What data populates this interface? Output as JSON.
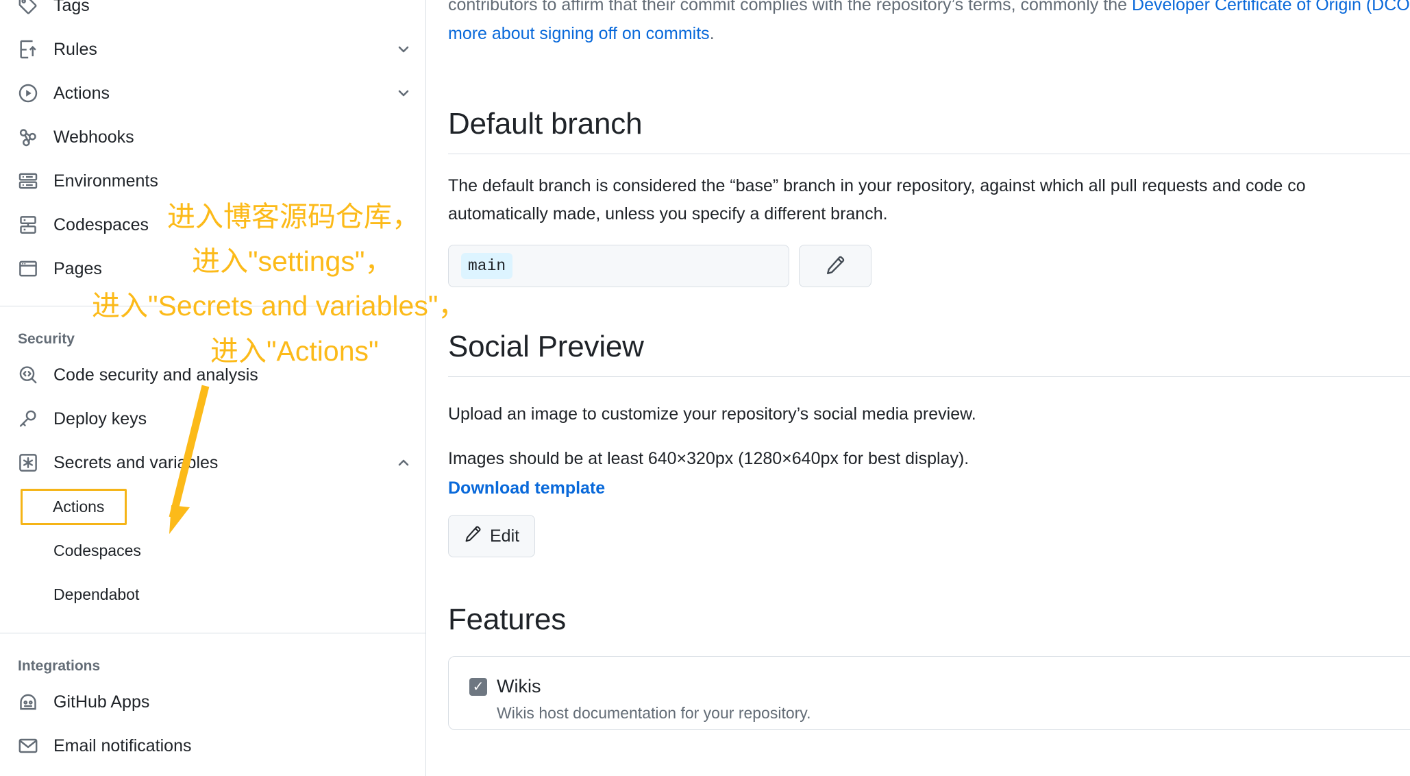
{
  "sidebar": {
    "items": [
      {
        "label": "Tags",
        "icon": "tag-icon",
        "chevron": null
      },
      {
        "label": "Rules",
        "icon": "rules-icon",
        "chevron": "down"
      },
      {
        "label": "Actions",
        "icon": "play-circle-icon",
        "chevron": "down"
      },
      {
        "label": "Webhooks",
        "icon": "webhook-icon",
        "chevron": null
      },
      {
        "label": "Environments",
        "icon": "server-icon",
        "chevron": null
      },
      {
        "label": "Codespaces",
        "icon": "codespaces-icon",
        "chevron": null
      },
      {
        "label": "Pages",
        "icon": "browser-icon",
        "chevron": null
      }
    ],
    "security_label": "Security",
    "security_items": [
      {
        "label": "Code security and analysis",
        "icon": "code-scan-icon",
        "chevron": null
      },
      {
        "label": "Deploy keys",
        "icon": "key-icon",
        "chevron": null
      },
      {
        "label": "Secrets and variables",
        "icon": "asterisk-icon",
        "chevron": "up"
      }
    ],
    "secrets_children": [
      {
        "label": "Actions",
        "selected": true
      },
      {
        "label": "Codespaces",
        "selected": false
      },
      {
        "label": "Dependabot",
        "selected": false
      }
    ],
    "integrations_label": "Integrations",
    "integration_items": [
      {
        "label": "GitHub Apps",
        "icon": "github-apps-icon"
      },
      {
        "label": "Email notifications",
        "icon": "mail-icon"
      }
    ]
  },
  "main": {
    "intro": {
      "line1_prefix": "contributors to affirm that their commit complies with the repository’s terms, commonly the ",
      "line1_link": "Developer Certificate of Origin (DCO)",
      "line2_link": "more about signing off on commits",
      "line2_suffix": "."
    },
    "default_branch": {
      "heading": "Default branch",
      "description_line1": "The default branch is considered the “base” branch in your repository, against which all pull requests and code co",
      "description_line2": "automatically made, unless you specify a different branch.",
      "branch_name": "main",
      "edit_icon": "pencil-icon"
    },
    "social_preview": {
      "heading": "Social Preview",
      "description_line1": "Upload an image to customize your repository’s social media preview.",
      "description_line2": "Images should be at least 640×320px (1280×640px for best display).",
      "download_link": "Download template",
      "edit_button": "Edit",
      "edit_icon": "pencil-icon"
    },
    "features": {
      "heading": "Features",
      "items": [
        {
          "name": "Wikis",
          "description": "Wikis host documentation for your repository.",
          "checked": true
        }
      ]
    }
  },
  "annotation": {
    "color": "#FCBA19",
    "lines": [
      "进入博客源码仓库，",
      "进入\"settings\"，",
      "进入\"Secrets and variables\"，",
      "进入\"Actions\""
    ],
    "arrow_target": "sidebar-secrets-actions"
  }
}
